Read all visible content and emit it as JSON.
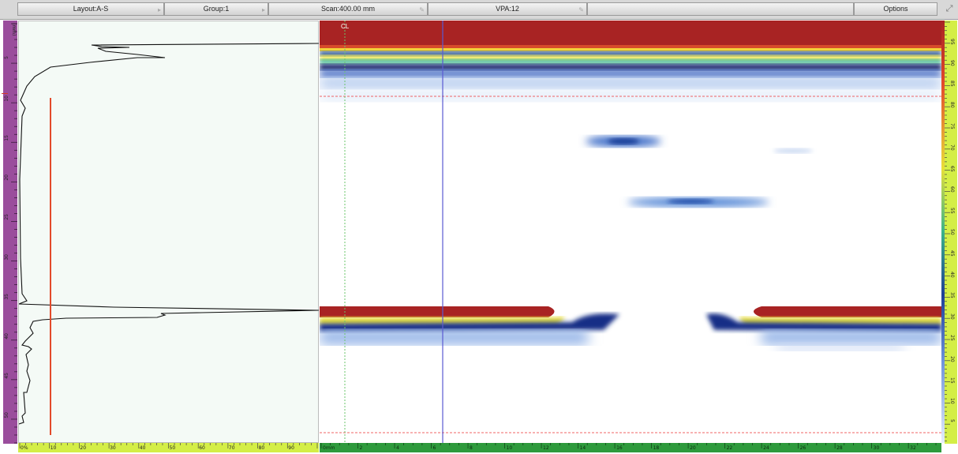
{
  "toolbar": {
    "layout_label": "Layout:A-S",
    "group_label": "Group:1",
    "scan_label": "Scan:400.00 mm",
    "vpa_label": "VPA:12",
    "options_label": "Options"
  },
  "ascan": {
    "depth_unit": "(mm)",
    "depth_ticks": [
      "5",
      "10",
      "15",
      "20",
      "25",
      "30",
      "35",
      "40",
      "45",
      "50"
    ],
    "amp_ticks": [
      "0%",
      "10",
      "20",
      "30",
      "40",
      "50",
      "60",
      "70",
      "80",
      "90"
    ]
  },
  "sscan": {
    "cl_label": "CL",
    "index_ticks": [
      "0mm",
      "2",
      "4",
      "6",
      "8",
      "10",
      "12",
      "14",
      "16",
      "18",
      "20",
      "22",
      "24",
      "26",
      "28",
      "30",
      "32"
    ],
    "palette_ticks": [
      "95",
      "90",
      "85",
      "80",
      "75",
      "70",
      "65",
      "60",
      "55",
      "50",
      "45",
      "40",
      "35",
      "30",
      "25",
      "20",
      "15",
      "10",
      "5"
    ]
  },
  "colors": {
    "ruler_purple": "#9a4d9c",
    "ruler_yellow": "#d4ee46",
    "ruler_green": "#2e9a3c",
    "gate_red": "#e34a2a",
    "signal_red": "#a82323",
    "palette_blue": "#162e86"
  }
}
